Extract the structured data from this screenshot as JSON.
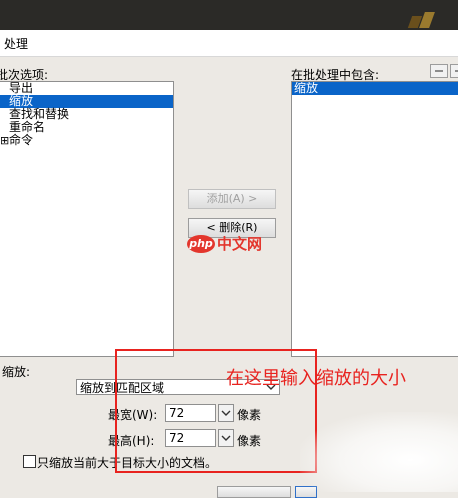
{
  "window": {
    "title": "处理"
  },
  "left_panel": {
    "label": "批次选项:",
    "items": [
      {
        "label": "导出",
        "selected": false,
        "expandable": false
      },
      {
        "label": "缩放",
        "selected": true,
        "expandable": false
      },
      {
        "label": "查找和替换",
        "selected": false,
        "expandable": false
      },
      {
        "label": "重命名",
        "selected": false,
        "expandable": false
      },
      {
        "label": "命令",
        "selected": false,
        "expandable": true
      }
    ]
  },
  "right_panel": {
    "label": "在批处理中包含:",
    "items": [
      {
        "label": "缩放",
        "selected": true
      }
    ]
  },
  "buttons": {
    "add": "添加(A) >",
    "remove": "< 删除(R)"
  },
  "watermark": {
    "logo": "php",
    "text": "中文网"
  },
  "scale_section": {
    "label": "缩放:",
    "mode": "缩放到匹配区域",
    "width_label": "最宽(W):",
    "width_value": "72",
    "height_label": "最高(H):",
    "height_value": "72",
    "unit": "像素",
    "only_larger_label": "只缩放当前大于目标大小的文档。",
    "only_larger_checked": false
  },
  "annotation": {
    "text": "在这里输入缩放的大小",
    "color": "#e8231f"
  },
  "colors": {
    "selection": "#0a64c8",
    "topbar": "#2b2a27"
  }
}
